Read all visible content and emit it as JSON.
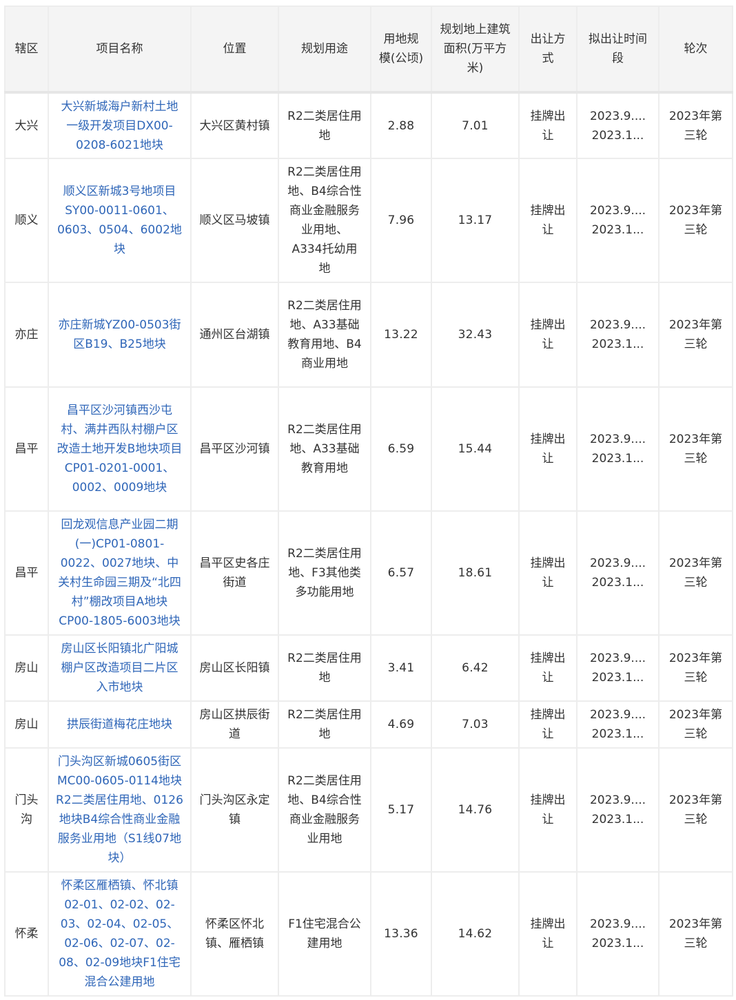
{
  "table": {
    "headers": {
      "district": "辖区",
      "project": "项目名称",
      "location": "位置",
      "usage": "规划用途",
      "area": "用地规模(公顷)",
      "floor_area": "规划地上建筑面积(万平方米)",
      "method": "出让方式",
      "period": "拟出让时间段",
      "round": "轮次"
    },
    "rows": [
      {
        "district": "大兴",
        "project": "大兴新城海户新村土地一级开发项目DX00-0208-6021地块",
        "location": "大兴区黄村镇",
        "usage": "R2二类居住用地",
        "area": "2.88",
        "floor_area": "7.01",
        "method": "挂牌出让",
        "period_start": "2023.9....",
        "period_end": "2023.1...",
        "round": "2023年第三轮"
      },
      {
        "district": "顺义",
        "project": "顺义区新城3号地项目SY00-0011-0601、0603、0504、6002地块",
        "location": "顺义区马坡镇",
        "usage": "R2二类居住用地、B4综合性商业金融服务业用地、A334托幼用地",
        "area": "7.96",
        "floor_area": "13.17",
        "method": "挂牌出让",
        "period_start": "2023.9....",
        "period_end": "2023.1...",
        "round": "2023年第三轮"
      },
      {
        "district": "亦庄",
        "project": "亦庄新城YZ00-0503街区B19、B25地块",
        "location": "通州区台湖镇",
        "usage": "R2二类居住用地、A33基础教育用地、B4商业用地",
        "area": "13.22",
        "floor_area": "32.43",
        "method": "挂牌出让",
        "period_start": "2023.9....",
        "period_end": "2023.1...",
        "round": "2023年第三轮"
      },
      {
        "district": "昌平",
        "project": "昌平区沙河镇西沙屯村、满井西队村棚户区改造土地开发B地块项目CP01-0201-0001、0002、0009地块",
        "location": "昌平区沙河镇",
        "usage": "R2二类居住用地、A33基础教育用地",
        "area": "6.59",
        "floor_area": "15.44",
        "method": "挂牌出让",
        "period_start": "2023.9....",
        "period_end": "2023.1...",
        "round": "2023年第三轮"
      },
      {
        "district": "昌平",
        "project": "回龙观信息产业园二期(一)CP01-0801-0022、0027地块、中关村生命园三期及“北四村”棚改项目A地块CP00-1805-6003地块",
        "location": "昌平区史各庄街道",
        "usage": "R2二类居住用地、F3其他类多功能用地",
        "area": "6.57",
        "floor_area": "18.61",
        "method": "挂牌出让",
        "period_start": "2023.9....",
        "period_end": "2023.1...",
        "round": "2023年第三轮"
      },
      {
        "district": "房山",
        "project": "房山区长阳镇北广阳城棚户区改造项目二片区入市地块",
        "location": "房山区长阳镇",
        "usage": "R2二类居住用地",
        "area": "3.41",
        "floor_area": "6.42",
        "method": "挂牌出让",
        "period_start": "2023.9....",
        "period_end": "2023.1...",
        "round": "2023年第三轮"
      },
      {
        "district": "房山",
        "project": "拱辰街道梅花庄地块",
        "location": "房山区拱辰街道",
        "usage": "R2二类居住用地",
        "area": "4.69",
        "floor_area": "7.03",
        "method": "挂牌出让",
        "period_start": "2023.9....",
        "period_end": "2023.1...",
        "round": "2023年第三轮"
      },
      {
        "district": "门头沟",
        "project": "门头沟区新城0605街区MC00-0605-0114地块R2二类居住用地、0126地块B4综合性商业金融服务业用地（S1线07地块）",
        "location": "门头沟区永定镇",
        "usage": "R2二类居住用地、B4综合性商业金融服务业用地",
        "area": "5.17",
        "floor_area": "14.76",
        "method": "挂牌出让",
        "period_start": "2023.9....",
        "period_end": "2023.1...",
        "round": "2023年第三轮"
      },
      {
        "district": "怀柔",
        "project": "怀柔区雁栖镇、怀北镇02-01、02-02、02-03、02-04、02-05、02-06、02-07、02-08、02-09地块F1住宅混合公建用地",
        "location": "怀柔区怀北镇、雁栖镇",
        "usage": "F1住宅混合公建用地",
        "area": "13.36",
        "floor_area": "14.62",
        "method": "挂牌出让",
        "period_start": "2023.9....",
        "period_end": "2023.1...",
        "round": "2023年第三轮"
      }
    ]
  }
}
